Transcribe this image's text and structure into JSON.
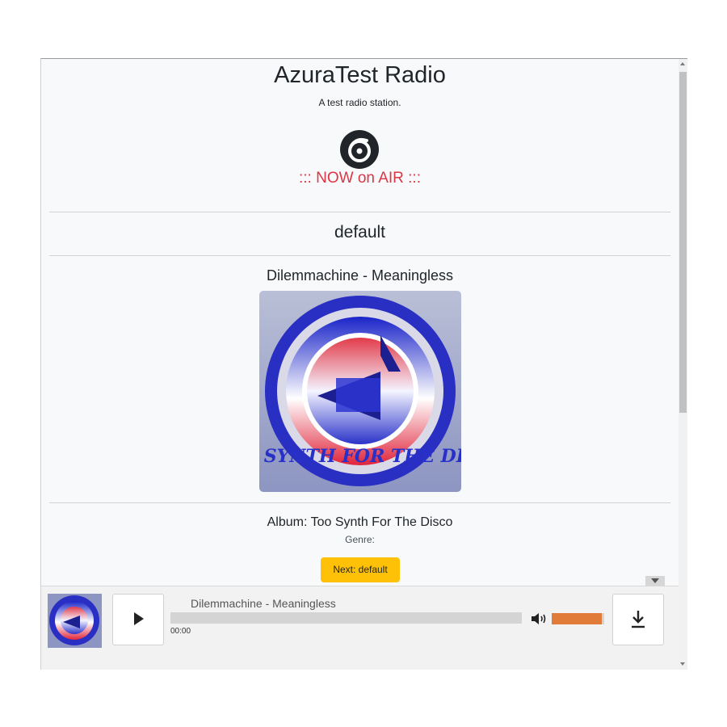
{
  "station": {
    "name": "AzuraTest Radio",
    "description": "A test radio station.",
    "on_air_label": "::: NOW on AIR :::"
  },
  "playlist": {
    "name": "default"
  },
  "now_playing": {
    "title": "Dilemmachine - Meaningless",
    "album_line": "Album: Too Synth For The Disco",
    "genre_line": "Genre:",
    "artwork_text": "TOO SYNTH FOR THE DISCO"
  },
  "next_button": {
    "label": "Next: default",
    "color": "#ffc107"
  },
  "player": {
    "track_title": "Dilemmachine - Meaningless",
    "elapsed": "00:00",
    "progress": 0,
    "volume": 0.95,
    "volume_color": "#e07b39",
    "play_icon": "play-icon",
    "volume_icon": "volume-icon",
    "download_icon": "download-icon"
  },
  "colors": {
    "on_air": "#dc3545",
    "background": "#f8f9fa"
  }
}
